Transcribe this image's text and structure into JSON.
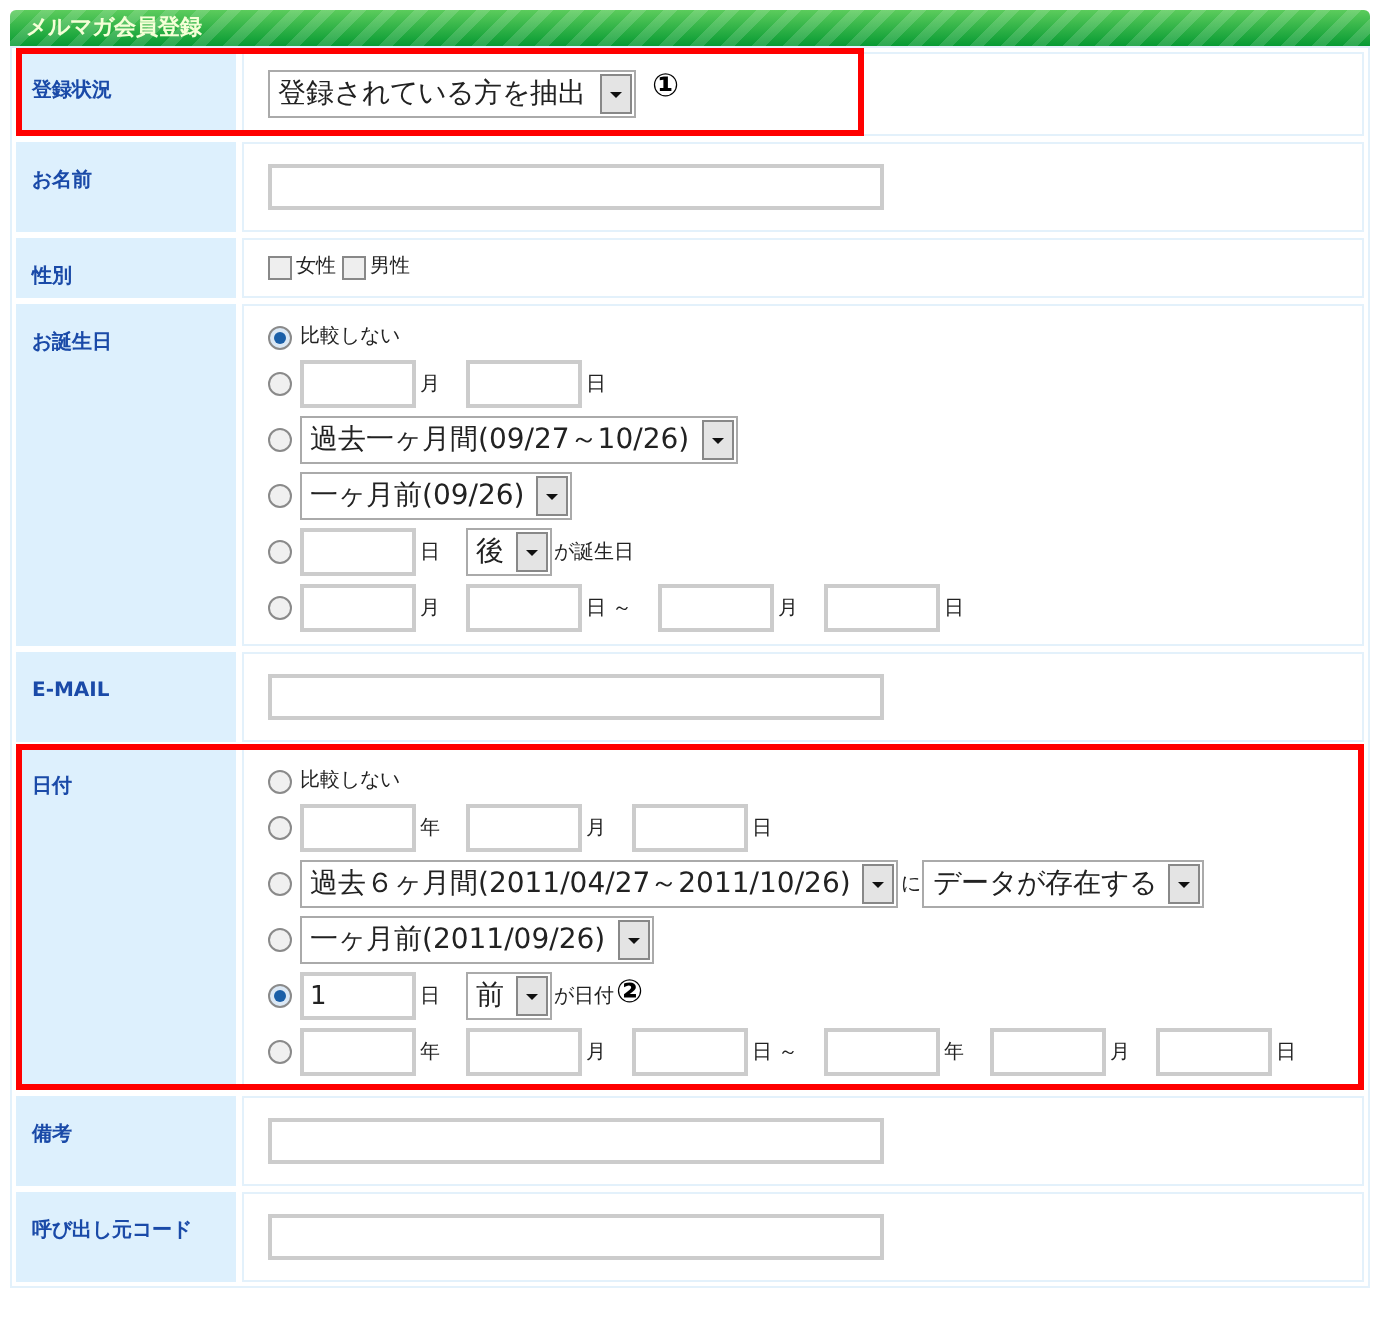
{
  "title": "メルマガ会員登録",
  "rows": [
    {
      "label": "登録状況",
      "kind": "select",
      "highlighted": true,
      "highlight_full_width": false,
      "select": "登録されている方を抽出",
      "annotation": "①"
    },
    {
      "label": "お名前",
      "kind": "text"
    },
    {
      "label": "性別",
      "kind": "checks",
      "checks": [
        {
          "label": "女性",
          "checked": false
        },
        {
          "label": "男性",
          "checked": false
        }
      ]
    },
    {
      "label": "お誕生日",
      "kind": "radios",
      "options": [
        {
          "selected": true,
          "parts": [
            {
              "kind": "note",
              "text": "比較しない"
            }
          ]
        },
        {
          "selected": false,
          "parts": [
            {
              "kind": "input"
            },
            {
              "kind": "unit",
              "text": "月"
            },
            {
              "kind": "input"
            },
            {
              "kind": "unit",
              "text": "日"
            }
          ]
        },
        {
          "selected": false,
          "parts": [
            {
              "kind": "select",
              "text": "過去一ヶ月間(09/27～10/26)"
            }
          ]
        },
        {
          "selected": false,
          "parts": [
            {
              "kind": "select",
              "text": "一ヶ月前(09/26)"
            }
          ]
        },
        {
          "selected": false,
          "parts": [
            {
              "kind": "input"
            },
            {
              "kind": "unit",
              "text": "日"
            },
            {
              "kind": "select",
              "text": "後"
            },
            {
              "kind": "note",
              "text": "が誕生日"
            }
          ]
        },
        {
          "selected": false,
          "parts": [
            {
              "kind": "input"
            },
            {
              "kind": "unit",
              "text": "月"
            },
            {
              "kind": "input"
            },
            {
              "kind": "unit",
              "text": "日 ～"
            },
            {
              "kind": "input"
            },
            {
              "kind": "unit",
              "text": "月"
            },
            {
              "kind": "input"
            },
            {
              "kind": "unit",
              "text": "日"
            }
          ]
        }
      ]
    },
    {
      "label": "E-MAIL",
      "kind": "text"
    },
    {
      "label": "日付",
      "kind": "radios",
      "highlighted": true,
      "highlight_full_width": true,
      "options": [
        {
          "selected": false,
          "parts": [
            {
              "kind": "note",
              "text": "比較しない"
            }
          ]
        },
        {
          "selected": false,
          "parts": [
            {
              "kind": "input"
            },
            {
              "kind": "unit",
              "text": "年"
            },
            {
              "kind": "input"
            },
            {
              "kind": "unit",
              "text": "月"
            },
            {
              "kind": "input"
            },
            {
              "kind": "unit",
              "text": "日"
            }
          ]
        },
        {
          "selected": false,
          "parts": [
            {
              "kind": "select",
              "text": "過去６ヶ月間(2011/04/27～2011/10/26)"
            },
            {
              "kind": "note",
              "text": "に"
            },
            {
              "kind": "select",
              "text": "データが存在する"
            }
          ]
        },
        {
          "selected": false,
          "parts": [
            {
              "kind": "select",
              "text": "一ヶ月前(2011/09/26)"
            }
          ]
        },
        {
          "selected": true,
          "parts": [
            {
              "kind": "input",
              "value": "1"
            },
            {
              "kind": "unit",
              "text": "日"
            },
            {
              "kind": "select",
              "text": "前"
            },
            {
              "kind": "note",
              "text": "が日付"
            },
            {
              "kind": "annotation",
              "text": "②"
            }
          ]
        },
        {
          "selected": false,
          "parts": [
            {
              "kind": "input"
            },
            {
              "kind": "unit",
              "text": "年"
            },
            {
              "kind": "input"
            },
            {
              "kind": "unit",
              "text": "月"
            },
            {
              "kind": "input"
            },
            {
              "kind": "unit",
              "text": "日 ～"
            },
            {
              "kind": "input"
            },
            {
              "kind": "unit",
              "text": "年"
            },
            {
              "kind": "input"
            },
            {
              "kind": "unit",
              "text": "月"
            },
            {
              "kind": "input"
            },
            {
              "kind": "unit",
              "text": "日"
            }
          ]
        }
      ]
    },
    {
      "label": "備考",
      "kind": "text"
    },
    {
      "label": "呼び出し元コード",
      "kind": "text"
    }
  ]
}
